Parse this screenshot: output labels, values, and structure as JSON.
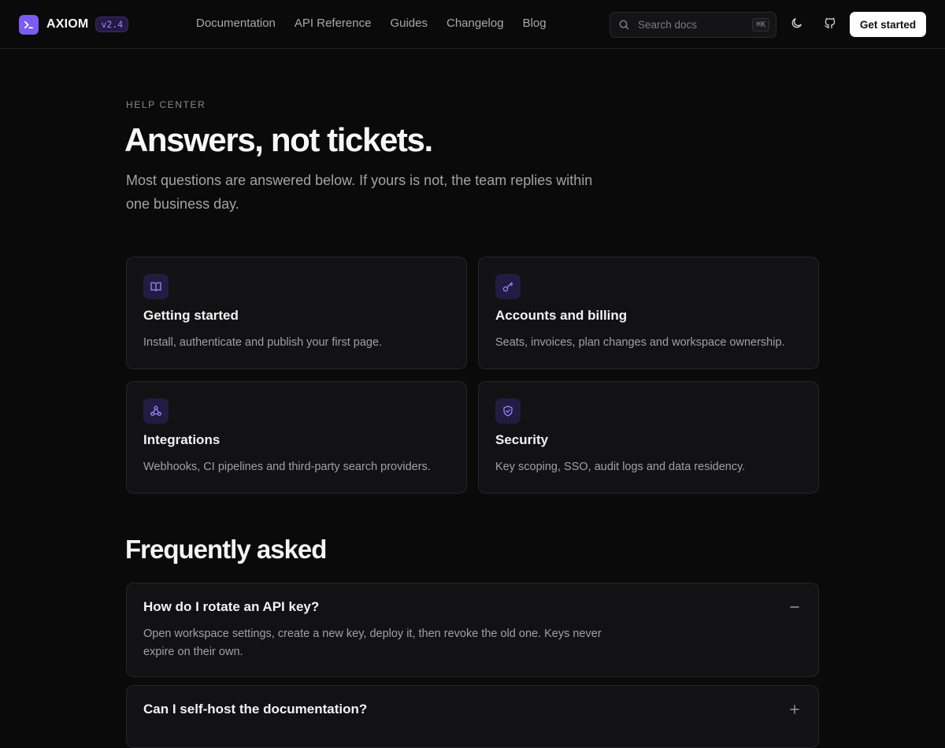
{
  "brand": {
    "name": "AXIOM",
    "version": "v2.4"
  },
  "nav": {
    "links": [
      "Documentation",
      "API Reference",
      "Guides",
      "Changelog",
      "Blog"
    ]
  },
  "search": {
    "placeholder": "Search docs",
    "shortcut": "⌘K"
  },
  "header": {
    "cta_label": "Get started"
  },
  "hero": {
    "eyebrow": "HELP CENTER",
    "title": "Answers, not tickets.",
    "subtitle": "Most questions are answered below. If yours is not, the team replies within one business day."
  },
  "topics": [
    {
      "icon": "book-icon",
      "title": "Getting started",
      "description": "Install, authenticate and publish your first page."
    },
    {
      "icon": "key-icon",
      "title": "Accounts and billing",
      "description": "Seats, invoices, plan changes and workspace ownership."
    },
    {
      "icon": "webhook-icon",
      "title": "Integrations",
      "description": "Webhooks, CI pipelines and third-party search providers."
    },
    {
      "icon": "shield-icon",
      "title": "Security",
      "description": "Key scoping, SSO, audit logs and data residency."
    }
  ],
  "faq": {
    "heading": "Frequently asked",
    "items": [
      {
        "question": "How do I rotate an API key?",
        "answer": "Open workspace settings, create a new key, deploy it, then revoke the old one. Keys never expire on their own.",
        "expanded": true
      },
      {
        "question": "Can I self-host the documentation?",
        "answer": "",
        "expanded": false
      }
    ]
  },
  "colors": {
    "background": "#0a0a0a",
    "surface": "#121214",
    "accent": "#7c5cf0",
    "accent_text": "#9e84ff"
  }
}
